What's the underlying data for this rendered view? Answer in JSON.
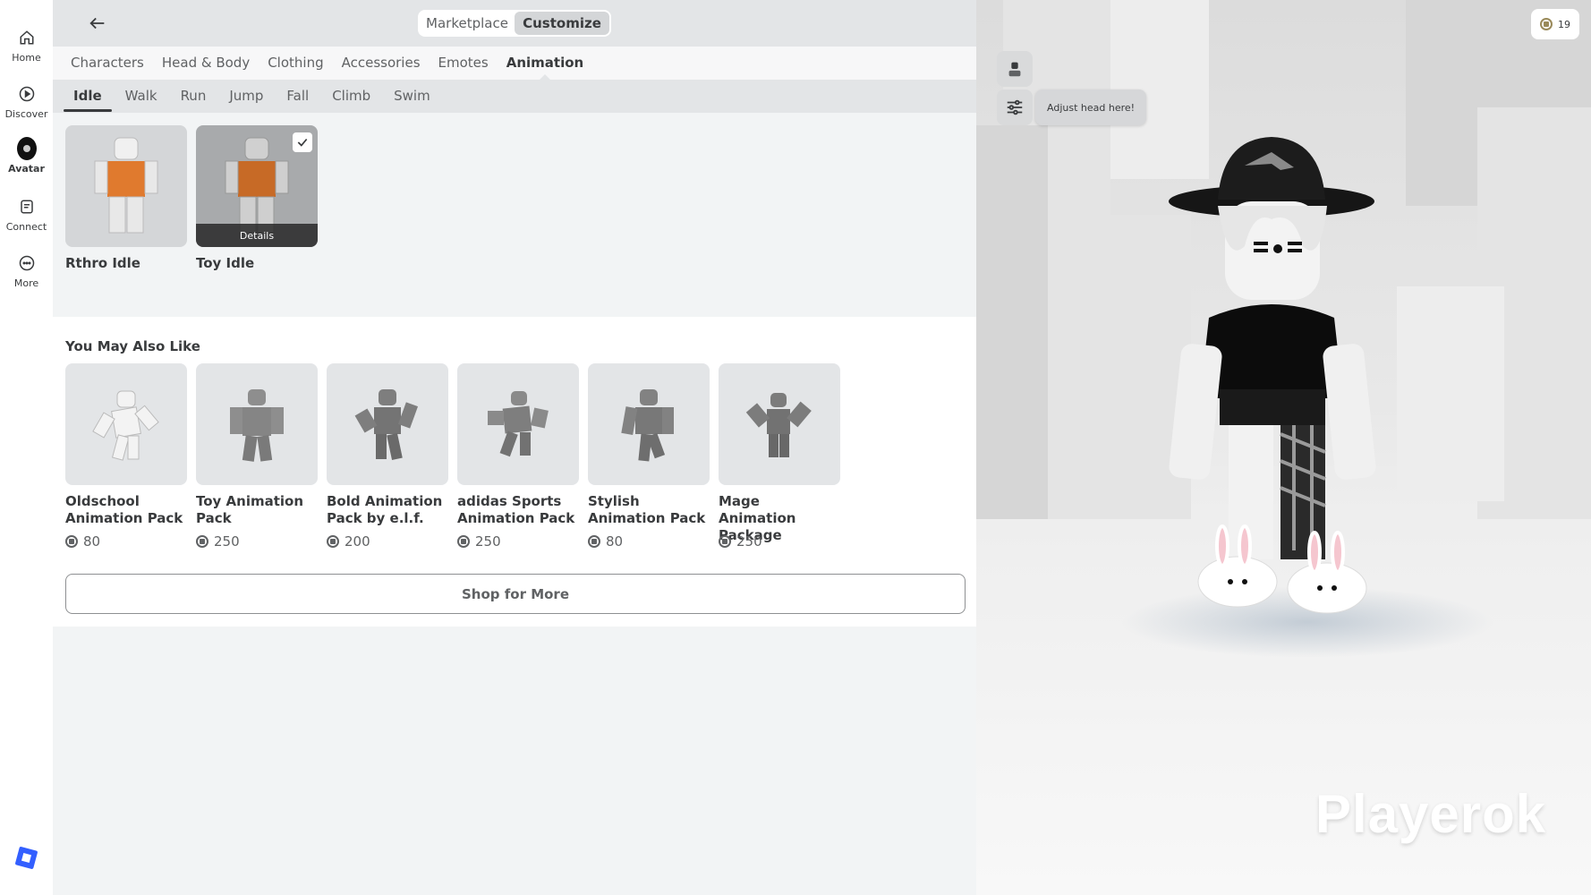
{
  "nav": {
    "items": [
      {
        "label": "Home",
        "icon": "home-icon"
      },
      {
        "label": "Discover",
        "icon": "play-circle-icon"
      },
      {
        "label": "Avatar",
        "icon": "avatar-icon"
      },
      {
        "label": "Connect",
        "icon": "chat-icon"
      },
      {
        "label": "More",
        "icon": "ellipsis-circle-icon"
      }
    ],
    "active": "Avatar"
  },
  "header": {
    "segments": [
      "Marketplace",
      "Customize"
    ],
    "active_segment": "Customize"
  },
  "categories": {
    "tabs": [
      "Characters",
      "Head & Body",
      "Clothing",
      "Accessories",
      "Emotes",
      "Animation"
    ],
    "active": "Animation"
  },
  "subcategories": {
    "tabs": [
      "Idle",
      "Walk",
      "Run",
      "Jump",
      "Fall",
      "Climb",
      "Swim"
    ],
    "active": "Idle"
  },
  "items": [
    {
      "name": "Rthro Idle",
      "selected": false,
      "details_label": ""
    },
    {
      "name": "Toy Idle",
      "selected": true,
      "details_label": "Details"
    }
  ],
  "recommendations": {
    "title": "You May Also Like",
    "items": [
      {
        "name": "Oldschool Animation Pack",
        "price": "80"
      },
      {
        "name": "Toy Animation Pack",
        "price": "250"
      },
      {
        "name": "Bold Animation Pack by e.l.f.",
        "price": "200"
      },
      {
        "name": "adidas Sports Animation Pack",
        "price": "250"
      },
      {
        "name": "Stylish Animation Pack",
        "price": "80"
      },
      {
        "name": "Mage Animation Package",
        "price": "250"
      }
    ],
    "shop_more_label": "Shop for More"
  },
  "preview": {
    "tooltip": "Adjust head here!",
    "robux_balance": "19",
    "watermark": "Playerok"
  },
  "colors": {
    "accent": "#335fff",
    "text": "#393b3d",
    "item_orange": "#e07a2e"
  }
}
